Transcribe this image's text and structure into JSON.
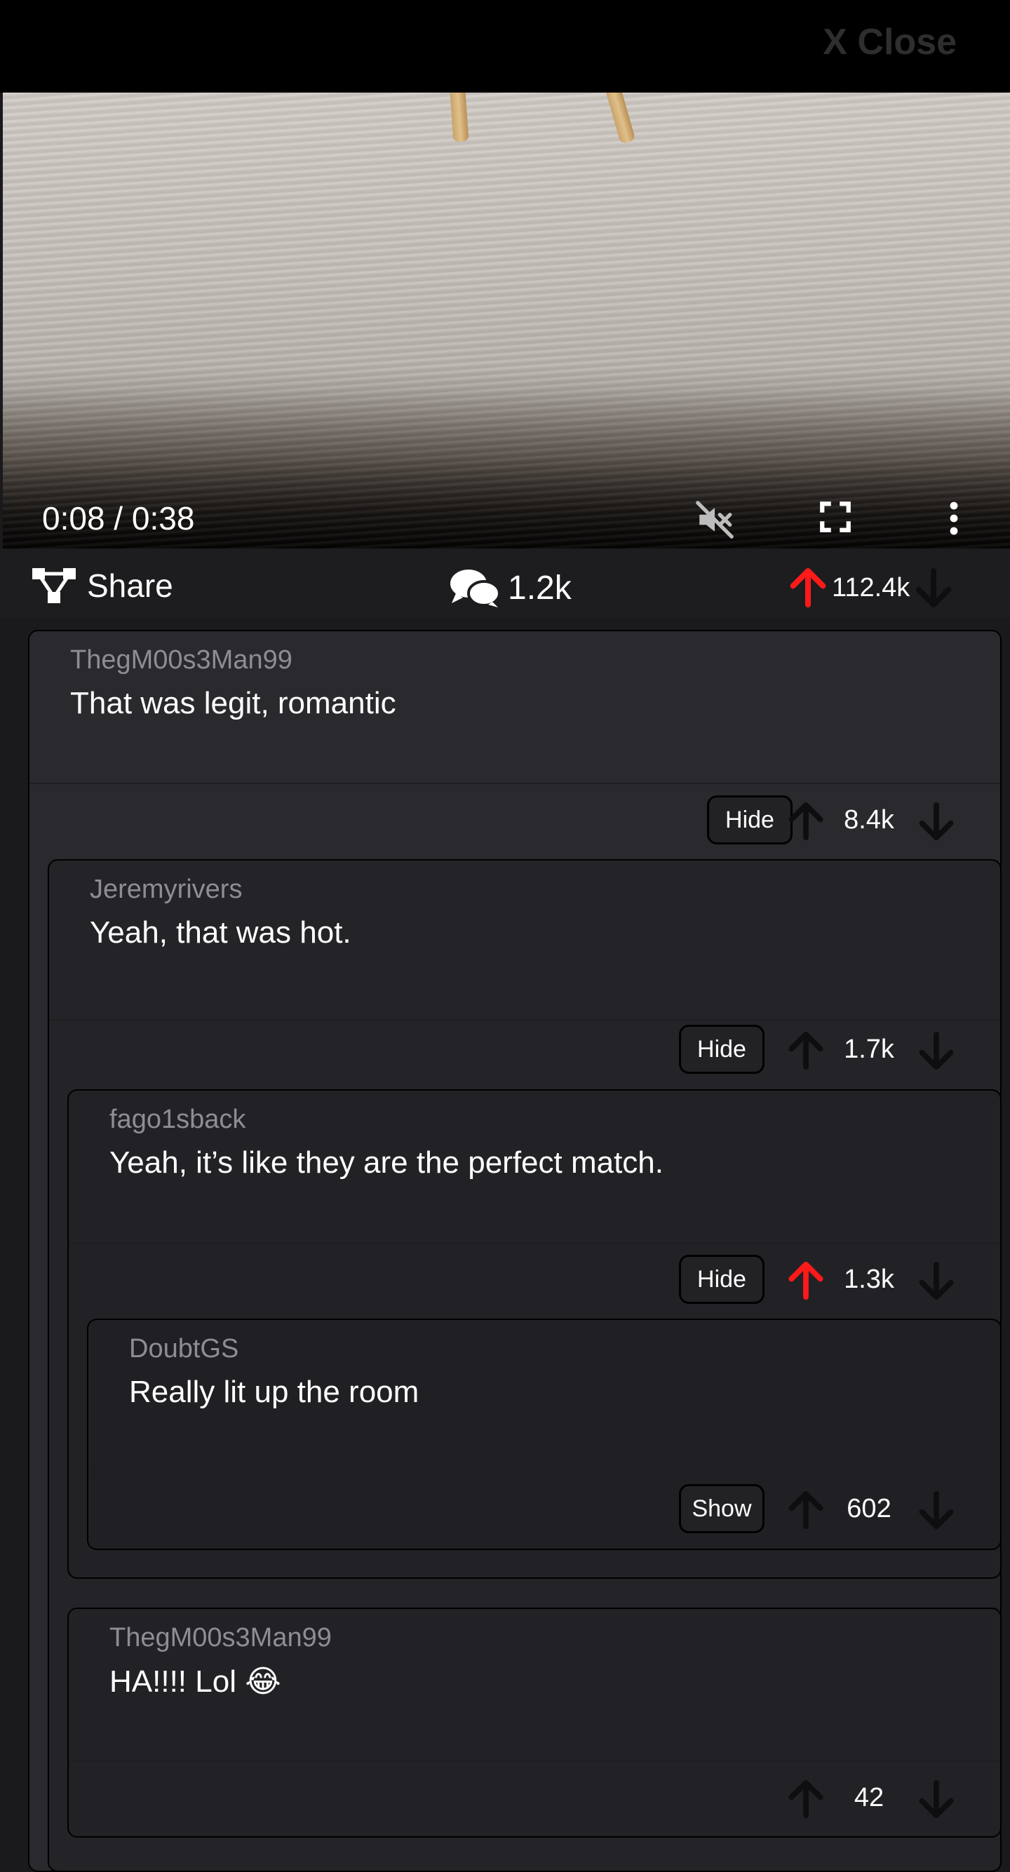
{
  "header": {
    "close_label": "X Close"
  },
  "video": {
    "time_display": "0:08 / 0:38",
    "progress": 0.22,
    "icons": [
      "mute-icon",
      "fullscreen-icon",
      "more-vert-icon"
    ]
  },
  "actions": {
    "share_label": "Share",
    "comment_count": "1.2k",
    "vote_count": "112.4k",
    "upvoted": true
  },
  "colors": {
    "upvote_active": "#ff1a1a",
    "arrow_inactive": "#0e0e10",
    "background": "#1a1a1c"
  },
  "comments": [
    {
      "author": "ThegM00s3Man99",
      "text": "That was legit, romantic",
      "toggle": "Hide",
      "votes": "8.4k",
      "upvoted": false
    },
    {
      "author": "Jeremyrivers",
      "text": "Yeah, that was hot.",
      "toggle": "Hide",
      "votes": "1.7k",
      "upvoted": false
    },
    {
      "author": "fago1sback",
      "text": "Yeah, it’s like they are the perfect match.",
      "toggle": "Hide",
      "votes": "1.3k",
      "upvoted": true
    },
    {
      "author": "DoubtGS",
      "text": "Really lit up the room",
      "toggle": "Show",
      "votes": "602",
      "upvoted": false
    },
    {
      "author": "ThegM00s3Man99",
      "text": "HA!!!! Lol 😂",
      "toggle": "",
      "votes": "42",
      "upvoted": false
    }
  ]
}
